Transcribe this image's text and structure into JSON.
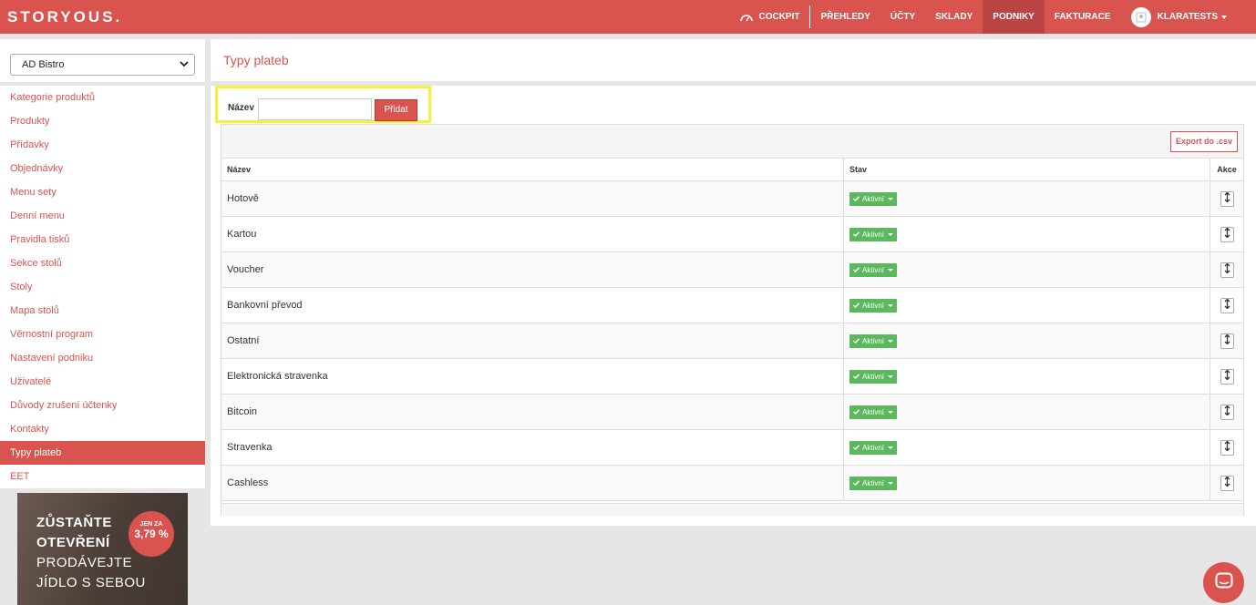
{
  "brand": {
    "logo_text": "STORYOUS",
    "logo_dot": ".",
    "accent_color": "#d9534f"
  },
  "nav": {
    "cockpit": "COCKPIT",
    "items": [
      {
        "label": "PŘEHLEDY",
        "active": false
      },
      {
        "label": "ÚČTY",
        "active": false
      },
      {
        "label": "SKLADY",
        "active": false
      },
      {
        "label": "PODNIKY",
        "active": true
      },
      {
        "label": "FAKTURACE",
        "active": false
      }
    ],
    "user": "KLARATESTS"
  },
  "sidebar": {
    "venue_selected": "AD Bistro",
    "items": [
      {
        "label": "Kategorie produktů",
        "active": false
      },
      {
        "label": "Produkty",
        "active": false
      },
      {
        "label": "Přídavky",
        "active": false
      },
      {
        "label": "Objednávky",
        "active": false
      },
      {
        "label": "Menu sety",
        "active": false
      },
      {
        "label": "Denní menu",
        "active": false
      },
      {
        "label": "Pravidla tisků",
        "active": false
      },
      {
        "label": "Sekce stolů",
        "active": false
      },
      {
        "label": "Stoly",
        "active": false
      },
      {
        "label": "Mapa stolů",
        "active": false
      },
      {
        "label": "Věrnostní program",
        "active": false
      },
      {
        "label": "Nastavení podniku",
        "active": false
      },
      {
        "label": "Uživatelé",
        "active": false
      },
      {
        "label": "Důvody zrušení účtenky",
        "active": false
      },
      {
        "label": "Kontakty",
        "active": false
      },
      {
        "label": "Typy plateb",
        "active": true
      },
      {
        "label": "EET",
        "active": false
      }
    ],
    "promo": {
      "line1": "ZŮSTAŇTE",
      "line2": "OTEVŘENÍ",
      "line3": "PRODÁVEJTE",
      "line4": "JÍDLO S SEBOU",
      "badge_small": "JEN ZA",
      "badge_big": "3,79 %"
    }
  },
  "page": {
    "title": "Typy plateb",
    "form": {
      "label": "Název",
      "input_value": "",
      "submit": "Přidat"
    },
    "export_label": "Export do .csv",
    "columns": {
      "name": "Název",
      "status": "Stav",
      "actions": "Akce"
    },
    "rows": [
      {
        "name": "Hotově",
        "status": "Aktivní"
      },
      {
        "name": "Kartou",
        "status": "Aktivní"
      },
      {
        "name": "Voucher",
        "status": "Aktivní"
      },
      {
        "name": "Bankovní převod",
        "status": "Aktivní"
      },
      {
        "name": "Ostatní",
        "status": "Aktivní"
      },
      {
        "name": "Elektronická stravenka",
        "status": "Aktivní"
      },
      {
        "name": "Bitcoin",
        "status": "Aktivní"
      },
      {
        "name": "Stravenka",
        "status": "Aktivní"
      },
      {
        "name": "Cashless",
        "status": "Aktivní"
      }
    ]
  },
  "icons": {
    "cockpit": "cockpit-gauge-icon",
    "status_check": "check-icon",
    "sort": "drag-sort-icon",
    "chat": "chat-icon"
  }
}
